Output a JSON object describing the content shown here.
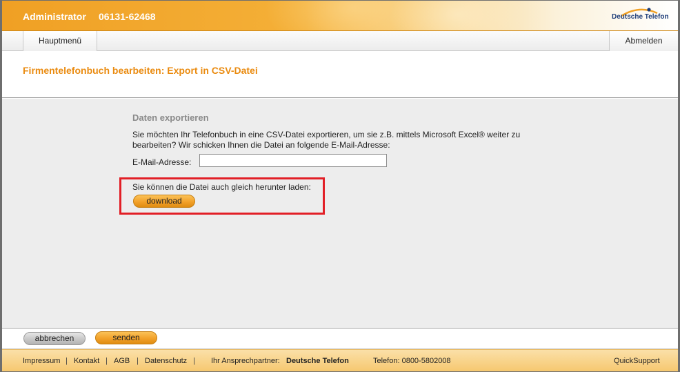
{
  "header": {
    "user": "Administrator",
    "phone": "06131-62468",
    "logo_text": "Deutsche Telefon"
  },
  "nav": {
    "home_label": "Hauptmenü",
    "logout_label": "Abmelden"
  },
  "page": {
    "title": "Firmentelefonbuch bearbeiten: Export in CSV-Datei"
  },
  "export": {
    "section_title": "Daten exportieren",
    "description": "Sie möchten Ihr Telefonbuch in eine CSV-Datei exportieren, um sie z.B. mittels Microsoft Excel® weiter zu bearbeiten? Wir schicken Ihnen die Datei an folgende E-Mail-Adresse:",
    "email_label": "E-Mail-Adresse:",
    "email_value": "",
    "download_text": "Sie können die Datei auch gleich herunter laden:",
    "download_label": "download"
  },
  "actions": {
    "cancel_label": "abbrechen",
    "send_label": "senden"
  },
  "footer": {
    "links": [
      "Impressum",
      "Kontakt",
      "AGB",
      "Datenschutz"
    ],
    "separator": "|",
    "contact_label": "Ihr Ansprechpartner:",
    "contact_name": "Deutsche Telefon",
    "phone_label": "Telefon: 0800-5802008",
    "support_label": "QuickSupport"
  },
  "colors": {
    "brand_orange": "#f0a024",
    "title_orange": "#ea8b10",
    "highlight_red": "#e21f26",
    "logo_blue": "#1d3c78"
  }
}
